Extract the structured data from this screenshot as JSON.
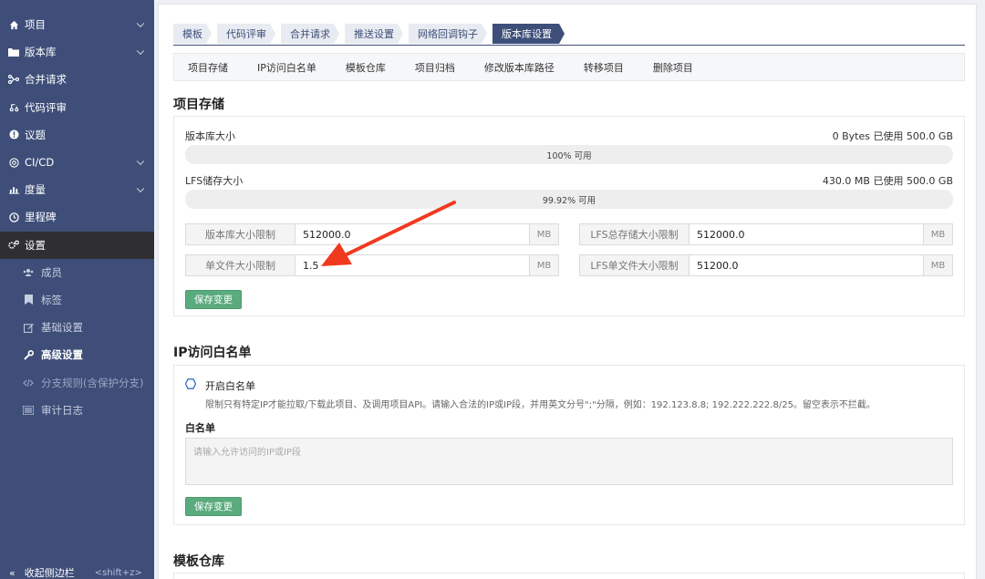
{
  "sidebar": {
    "items": [
      {
        "label": "项目",
        "icon": "home-icon",
        "chevron": true
      },
      {
        "label": "版本库",
        "icon": "folder-icon",
        "chevron": true
      },
      {
        "label": "合并请求",
        "icon": "merge-icon",
        "chevron": false
      },
      {
        "label": "代码评审",
        "icon": "review-icon",
        "chevron": false
      },
      {
        "label": "议题",
        "icon": "issue-icon",
        "chevron": false
      },
      {
        "label": "CI/CD",
        "icon": "cicd-icon",
        "chevron": true
      },
      {
        "label": "度量",
        "icon": "chart-icon",
        "chevron": true
      },
      {
        "label": "里程碑",
        "icon": "clock-icon",
        "chevron": false
      },
      {
        "label": "设置",
        "icon": "gear-icon",
        "chevron": false
      }
    ],
    "subitems": [
      {
        "label": "成员",
        "icon": "users-icon"
      },
      {
        "label": "标签",
        "icon": "bookmark-icon"
      },
      {
        "label": "基础设置",
        "icon": "edit-icon"
      },
      {
        "label": "高级设置",
        "icon": "wrench-icon"
      },
      {
        "label": "分支规则(含保护分支)",
        "icon": "code-icon"
      },
      {
        "label": "审计日志",
        "icon": "log-icon"
      }
    ],
    "collapse_label": "收起侧边栏",
    "collapse_shortcut": "<shift+z>"
  },
  "tabs": [
    "模板",
    "代码评审",
    "合并请求",
    "推送设置",
    "网络回调钩子",
    "版本库设置"
  ],
  "subnav": [
    "项目存储",
    "IP访问白名单",
    "模板仓库",
    "项目归档",
    "修改版本库路径",
    "转移项目",
    "删除项目"
  ],
  "storage": {
    "title": "项目存储",
    "repo_size_label": "版本库大小",
    "repo_usage": "0 Bytes 已使用 500.0 GB",
    "repo_bar": "100% 可用",
    "repo_available_fraction": 1.0,
    "lfs_size_label": "LFS储存大小",
    "lfs_usage": "430.0 MB 已使用 500.0 GB",
    "lfs_bar": "99.92% 可用",
    "lfs_available_fraction": 0.9992,
    "fields": [
      {
        "label": "版本库大小限制",
        "value": "512000.0",
        "unit": "MB"
      },
      {
        "label": "LFS总存储大小限制",
        "value": "512000.0",
        "unit": "MB"
      },
      {
        "label": "单文件大小限制",
        "value": "1.5",
        "unit": "MB"
      },
      {
        "label": "LFS单文件大小限制",
        "value": "51200.0",
        "unit": "MB"
      }
    ],
    "save_label": "保存变更"
  },
  "whitelist": {
    "title": "IP访问白名单",
    "enable_label": "开启白名单",
    "description": "限制只有特定IP才能拉取/下载此项目、及调用项目API。请输入合法的IP或IP段，并用英文分号\";\"分隔，例如：192.123.8.8; 192.222.222.8/25。留空表示不拦截。",
    "list_label": "白名单",
    "placeholder": "请输入允许访问的IP或IP段",
    "save_label": "保存变更"
  },
  "template": {
    "title": "模板仓库"
  },
  "colors": {
    "sidebar": "#3e4e79",
    "active_item": "#2f2f33",
    "save_button": "#5aab7d",
    "arrow": "#f03a1f"
  }
}
